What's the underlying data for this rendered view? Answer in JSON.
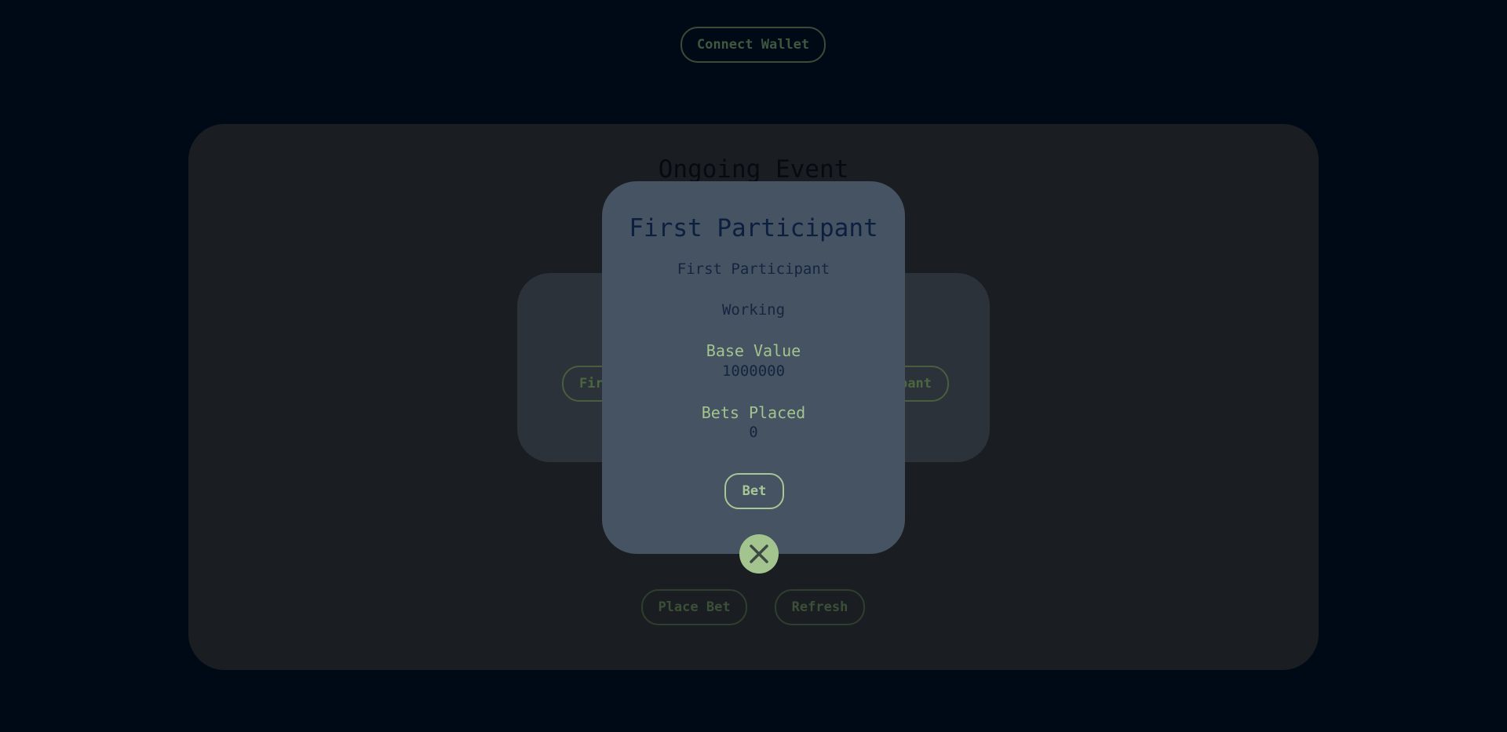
{
  "header": {
    "connect_wallet_label": "Connect Wallet"
  },
  "event": {
    "title": "Ongoing Event",
    "participant_one_label": "First Participant",
    "participant_two_label": "Second Participant",
    "place_bet_label": "Place Bet",
    "refresh_label": "Refresh"
  },
  "modal": {
    "title": "First Participant",
    "name": "First Participant",
    "status": "Working",
    "base_value_label": "Base Value",
    "base_value": "1000000",
    "bets_placed_label": "Bets Placed",
    "bets_placed": "0",
    "bet_label": "Bet",
    "close_icon": "close-icon"
  },
  "colors": {
    "background": "#000a17",
    "panel": "#1a1e22",
    "card": "#2b3239",
    "modal": "#465363",
    "accent": "#a3c48e",
    "modal_text": "#0d1f3f"
  }
}
